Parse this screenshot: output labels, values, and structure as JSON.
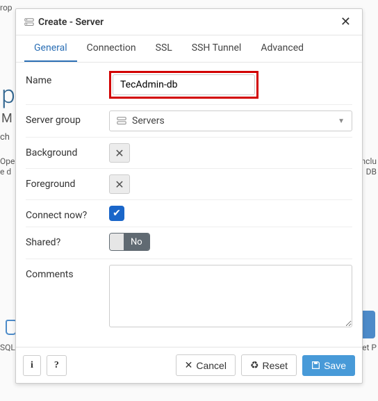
{
  "dialog": {
    "title": "Create - Server",
    "tabs": [
      "General",
      "Connection",
      "SSL",
      "SSH Tunnel",
      "Advanced"
    ],
    "activeTab": 0
  },
  "form": {
    "name_label": "Name",
    "name_value": "TecAdmin-db",
    "group_label": "Server group",
    "group_value": "Servers",
    "background_label": "Background",
    "foreground_label": "Foreground",
    "connect_label": "Connect now?",
    "shared_label": "Shared?",
    "shared_state": "No",
    "comments_label": "Comments",
    "comments_value": ""
  },
  "footer": {
    "info": "i",
    "help": "?",
    "cancel": "Cancel",
    "reset": "Reset",
    "save": "Save"
  },
  "backdrop": {
    "rop": "rop",
    "p": "p",
    "m": "M",
    "ch": "ch",
    "ope": "Ope",
    "ed": "e d",
    "nclu": "nclu",
    "db": "DB",
    "etp": "et P",
    "sql": "SQL"
  }
}
